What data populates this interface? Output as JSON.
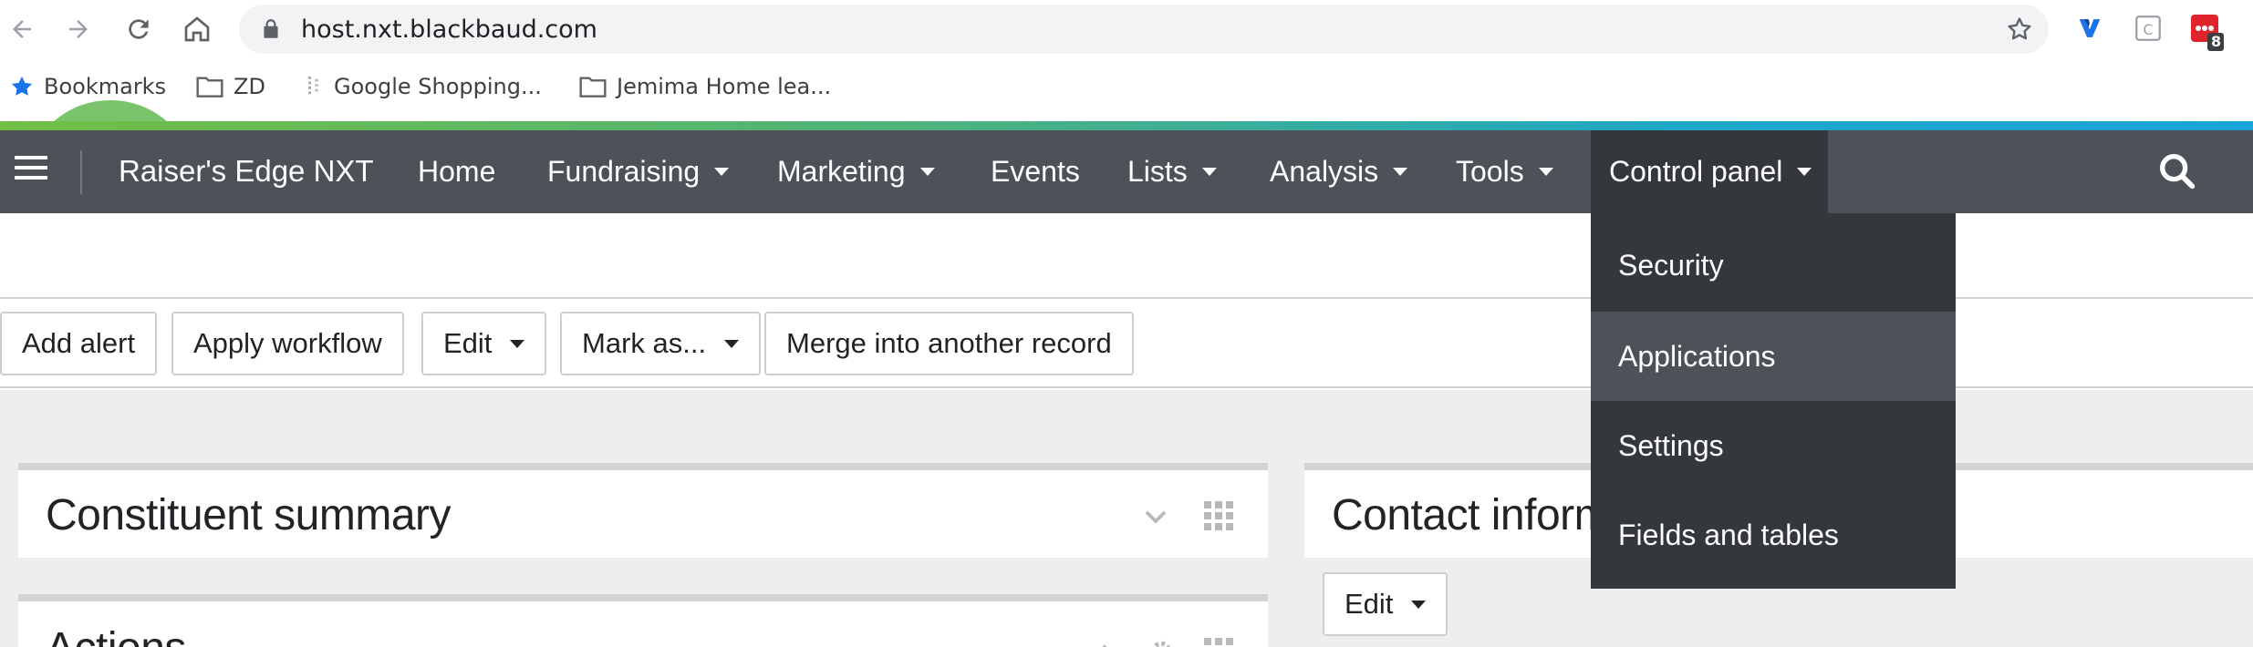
{
  "browser": {
    "url": "host.nxt.blackbaud.com",
    "extension_badge": "8",
    "icons": [
      "back-arrow-icon",
      "forward-arrow-icon",
      "reload-icon",
      "home-icon",
      "lock-icon",
      "star-icon",
      "vivaldi-extension-icon",
      "calendar-extension-icon",
      "red-extension-icon"
    ]
  },
  "bookmarks": {
    "items": [
      {
        "label": "Bookmarks",
        "icon": "star-icon"
      },
      {
        "label": "ZD",
        "icon": "folder-icon"
      },
      {
        "label": "Google Shopping...",
        "icon": "page-icon"
      },
      {
        "label": "Jemima Home lea...",
        "icon": "folder-icon"
      }
    ]
  },
  "app_nav": {
    "brand": "Raiser's Edge NXT",
    "items": [
      {
        "label": "Home",
        "has_menu": false
      },
      {
        "label": "Fundraising",
        "has_menu": true
      },
      {
        "label": "Marketing",
        "has_menu": true
      },
      {
        "label": "Events",
        "has_menu": false
      },
      {
        "label": "Lists",
        "has_menu": true
      },
      {
        "label": "Analysis",
        "has_menu": true
      },
      {
        "label": "Tools",
        "has_menu": true
      },
      {
        "label": "Control panel",
        "has_menu": true
      }
    ],
    "colors": {
      "nav_bg": "#4d5259",
      "active_bg": "#34373c",
      "accent_start": "#71bf44",
      "accent_end": "#1aa3d8"
    }
  },
  "control_panel_menu": {
    "items": [
      "Security",
      "Applications",
      "Settings",
      "Fields and tables"
    ],
    "highlighted": "Applications"
  },
  "record_actions": {
    "add_alert": "Add alert",
    "apply_workflow": "Apply workflow",
    "edit": "Edit",
    "mark_as": "Mark as...",
    "merge": "Merge into another record"
  },
  "tiles": {
    "constituent_summary": "Constituent summary",
    "actions": "Actions",
    "contact_information": "Contact informa",
    "contact_edit": "Edit"
  }
}
